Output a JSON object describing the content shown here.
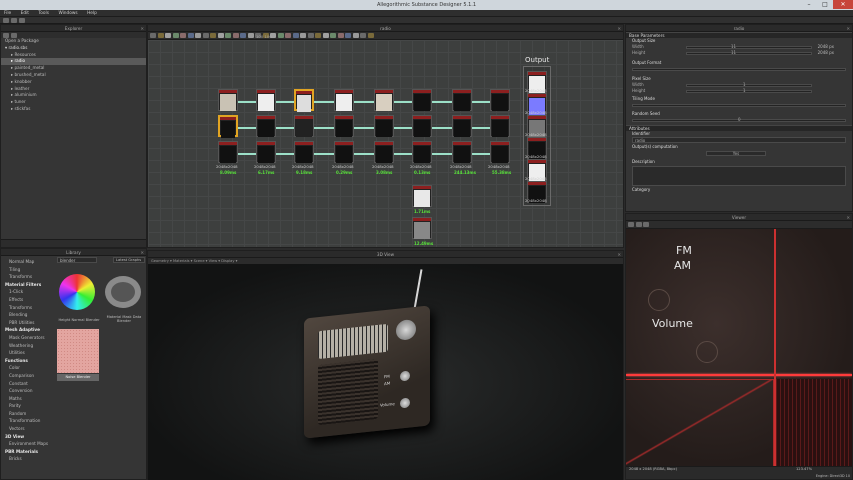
{
  "window": {
    "title": "Allegorithmic Substance Designer 5.1.1"
  },
  "menu": [
    "File",
    "Edit",
    "Tools",
    "Windows",
    "Help"
  ],
  "explorer": {
    "title": "Explorer",
    "open_label": "Open a Package",
    "root": "radio.sbs",
    "items": [
      {
        "label": "Resources",
        "selected": false
      },
      {
        "label": "radio",
        "selected": true
      },
      {
        "label": "painted_metal",
        "selected": false
      },
      {
        "label": "brushed_metal",
        "selected": false
      },
      {
        "label": "knobber",
        "selected": false
      },
      {
        "label": "leather",
        "selected": false
      },
      {
        "label": "aluminium",
        "selected": false
      },
      {
        "label": "tuner",
        "selected": false
      },
      {
        "label": "stickfas",
        "selected": false
      }
    ]
  },
  "graph": {
    "title": "radio",
    "zoom": "100 100",
    "output_label": "Output",
    "columns": [
      {
        "res": "2048x2048",
        "time": "8.09ms"
      },
      {
        "res": "2048x2048",
        "time": "6.17ms"
      },
      {
        "res": "2048x2048",
        "time": "9.18ms"
      },
      {
        "res": "2048x2048",
        "time": "0.29ms"
      },
      {
        "res": "2048x2048",
        "time": "3.08ms"
      },
      {
        "res": "2048x2048",
        "time": "0.13ms"
      },
      {
        "res": "2048x2048",
        "time": "244.13ms"
      },
      {
        "res": "2048x2048",
        "time": "55.38ms"
      }
    ],
    "extra_nodes": [
      {
        "res": "2048x2048",
        "time": "1.71ms"
      },
      {
        "res": "2048x2048",
        "time": "12.49ms"
      }
    ],
    "outputs": [
      {
        "res": "2048x2048",
        "time": "0ms"
      },
      {
        "res": "2048x2048",
        "time": "0ms"
      },
      {
        "res": "2048x2048",
        "time": "0ms"
      },
      {
        "res": "2048x2048",
        "time": "0ms"
      },
      {
        "res": "2048x2048",
        "time": "0ms"
      },
      {
        "res": "2048x2048",
        "time": "0ms"
      }
    ]
  },
  "properties": {
    "title": "radio",
    "base_section": "Base Parameters",
    "output_size_label": "Output Size",
    "width_label": "Width",
    "height_label": "Height",
    "width_value": "11",
    "height_value": "11",
    "width_px": "2048 px",
    "height_px": "2048 px",
    "output_format_label": "Output Format",
    "pixel_size_label": "Pixel Size",
    "px_width_value": "1",
    "px_height_value": "1",
    "tiling_label": "Tiling Mode",
    "random_seed_label": "Random Seed",
    "random_seed_value": "0",
    "attributes_section": "Attributes",
    "identifier_label": "Identifier",
    "identifier_value": "radio",
    "outputs_computation_label": "Output(s) computation",
    "outputs_computation_value": "Yes",
    "description_label": "Description",
    "category_label": "Category"
  },
  "viewer2d": {
    "title": "Viewer",
    "status": "2048 x 2048 (RGBA, 8bpc)",
    "zoom": "123.47%",
    "engine": "Engine: Direct3D 10",
    "texture_labels": [
      "FM",
      "AM",
      "Volume"
    ]
  },
  "viewer3d": {
    "title": "3D View",
    "menu": "Geometry ▾  Materials ▾  Scene ▾  View ▾  Display ▾",
    "knob_labels": [
      "FM",
      "AM",
      "Volume"
    ]
  },
  "library": {
    "title": "Library",
    "search_value": "blender",
    "filter_label": "Latest Graphs",
    "categories": [
      "Normal Map",
      "Tiling",
      "Transforms",
      "Material Filters",
      "1-Click",
      "Effects",
      "Transforms",
      "Blending",
      "PBR Utilities",
      "Mesh Adaptive",
      "Mask Generators",
      "Weathering",
      "Utilities",
      "Functions",
      "Color",
      "Comparison",
      "Constant",
      "Conversion",
      "Maths",
      "Parity",
      "Random",
      "Transformation",
      "Vectors",
      "3D View",
      "Environment Maps",
      "PBR Materials",
      "Bricks"
    ],
    "thumbnails": [
      "Height Normal Blender",
      "Material Mask Data Blender",
      "Noise Blender"
    ]
  },
  "colors": {
    "wire": "#9ce0c8",
    "accent": "#58e03a",
    "selected_node": "#e1a422",
    "node_header": "#8c1f1f"
  }
}
